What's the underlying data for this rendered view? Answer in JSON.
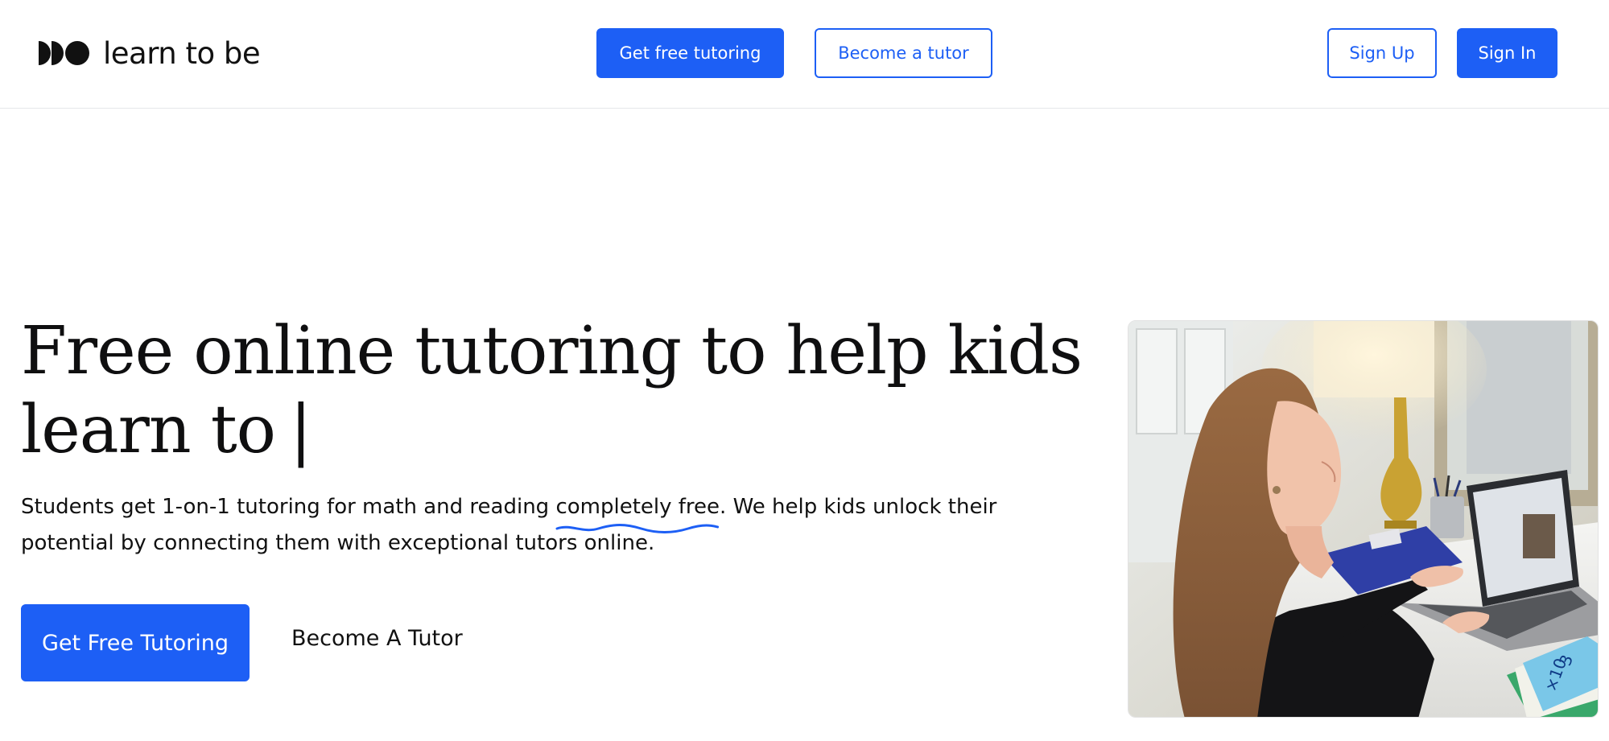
{
  "header": {
    "logo_text": "learn to be",
    "nav": {
      "get_free_tutoring": "Get free tutoring",
      "become_tutor": "Become a tutor"
    },
    "auth": {
      "sign_up": "Sign Up",
      "sign_in": "Sign In"
    }
  },
  "hero": {
    "headline_line1": "Free online tutoring to help kids",
    "headline_line2": "learn to",
    "caret": "|",
    "subtext_before": "Students get 1-on-1 tutoring for math and reading ",
    "subtext_highlight": "completely free",
    "subtext_after": ". We help kids unlock their potential by connecting them with exceptional tutors online.",
    "cta_primary": "Get Free Tutoring",
    "cta_secondary": "Become A Tutor",
    "flashcard_top": "3",
    "flashcard_bottom": "×10"
  },
  "colors": {
    "brand_blue": "#1d5ff5",
    "text_dark": "#111111",
    "divider": "#e6e7ea"
  }
}
